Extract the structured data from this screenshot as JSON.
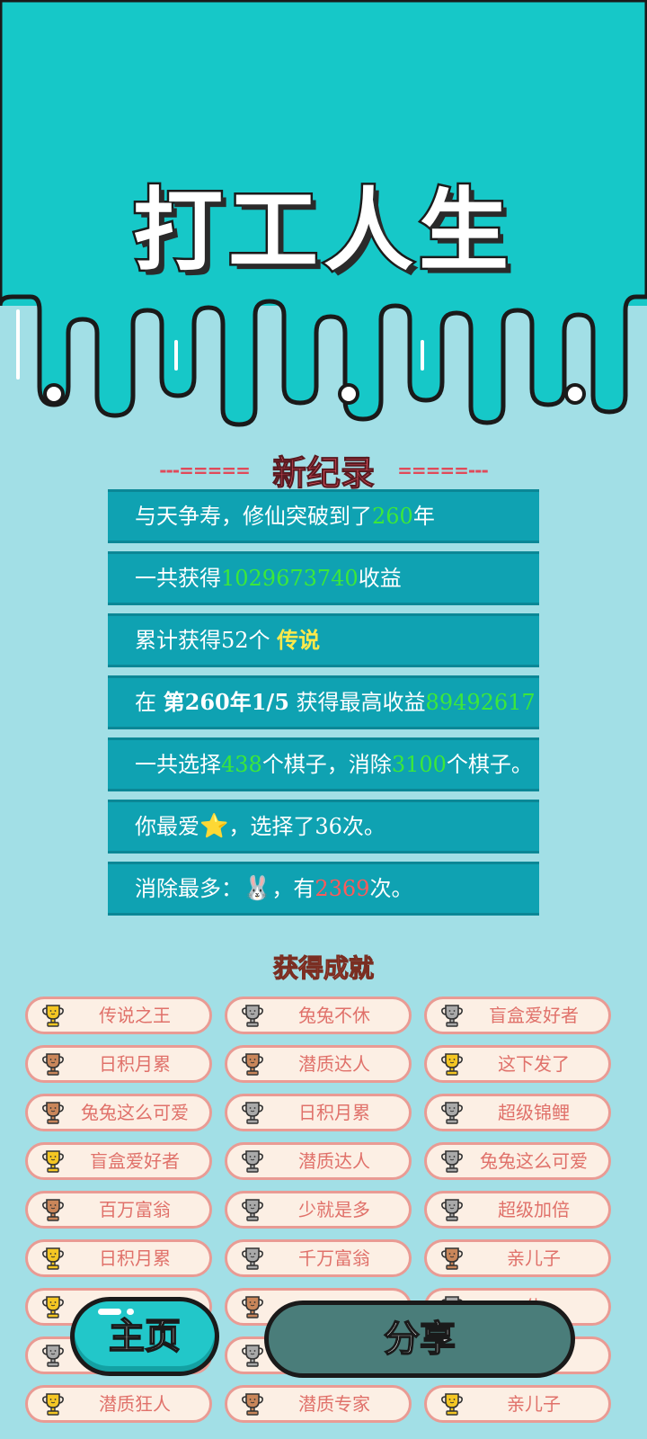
{
  "app": {
    "title": "打工人生"
  },
  "record": {
    "title": "新纪录",
    "left_dashes": "---=====",
    "right_dashes": "=====---"
  },
  "stats": [
    {
      "parts": [
        {
          "t": "与天争寿，修仙突破到了"
        },
        {
          "t": "260",
          "c": "g"
        },
        {
          "t": "年"
        }
      ]
    },
    {
      "parts": [
        {
          "t": "一共获得"
        },
        {
          "t": "1029673740",
          "c": "g"
        },
        {
          "t": "收益"
        }
      ]
    },
    {
      "parts": [
        {
          "t": "累计获得52个 "
        },
        {
          "t": "传说",
          "c": "y"
        }
      ]
    },
    {
      "parts": [
        {
          "t": "在 "
        },
        {
          "t": "第260年1/5",
          "c": "b"
        },
        {
          "t": " 获得最高收益"
        },
        {
          "t": "89492617",
          "c": "g"
        }
      ]
    },
    {
      "parts": [
        {
          "t": "一共选择"
        },
        {
          "t": "438",
          "c": "g"
        },
        {
          "t": "个棋子，消除"
        },
        {
          "t": "3100",
          "c": "g"
        },
        {
          "t": "个棋子。"
        }
      ]
    },
    {
      "parts": [
        {
          "t": "你最爱"
        },
        {
          "t": "⭐",
          "c": "icon"
        },
        {
          "t": "，选择了36次。"
        }
      ]
    },
    {
      "parts": [
        {
          "t": "消除最多："
        },
        {
          "t": "🐰",
          "c": "icon"
        },
        {
          "t": "，有"
        },
        {
          "t": "2369",
          "c": "r"
        },
        {
          "t": "次。"
        }
      ]
    }
  ],
  "achievements_title": "获得成就",
  "achievements": [
    {
      "label": "传说之王",
      "cup": "gold"
    },
    {
      "label": "兔兔不休",
      "cup": "silver"
    },
    {
      "label": "盲盒爱好者",
      "cup": "silver"
    },
    {
      "label": "日积月累",
      "cup": "bronze"
    },
    {
      "label": "潜质达人",
      "cup": "bronze"
    },
    {
      "label": "这下发了",
      "cup": "gold"
    },
    {
      "label": "兔兔这么可爱",
      "cup": "bronze"
    },
    {
      "label": "日积月累",
      "cup": "silver"
    },
    {
      "label": "超级锦鲤",
      "cup": "silver"
    },
    {
      "label": "盲盒爱好者",
      "cup": "gold"
    },
    {
      "label": "潜质达人",
      "cup": "silver"
    },
    {
      "label": "兔兔这么可爱",
      "cup": "silver"
    },
    {
      "label": "百万富翁",
      "cup": "bronze"
    },
    {
      "label": "少就是多",
      "cup": "silver"
    },
    {
      "label": "超级加倍",
      "cup": "silver"
    },
    {
      "label": "日积月累",
      "cup": "gold"
    },
    {
      "label": "千万富翁",
      "cup": "silver"
    },
    {
      "label": "亲儿子",
      "cup": "bronze"
    },
    {
      "label": "",
      "cup": "gold"
    },
    {
      "label": "",
      "cup": "bronze"
    },
    {
      "label": "休",
      "cup": "silver"
    },
    {
      "label": "",
      "cup": "silver"
    },
    {
      "label": "",
      "cup": "silver"
    },
    {
      "label": "人",
      "cup": "silver"
    },
    {
      "label": "潜质狂人",
      "cup": "gold"
    },
    {
      "label": "潜质专家",
      "cup": "bronze"
    },
    {
      "label": "亲儿子",
      "cup": "gold"
    }
  ],
  "buttons": {
    "home": "主页",
    "share": "分享"
  },
  "colors": {
    "teal_top": "#16c8c8",
    "bg": "#a2dfe6",
    "stat_bg": "#0fa2b2",
    "gold": "#f4c623",
    "silver": "#a9a9a9",
    "bronze": "#c9865a"
  }
}
